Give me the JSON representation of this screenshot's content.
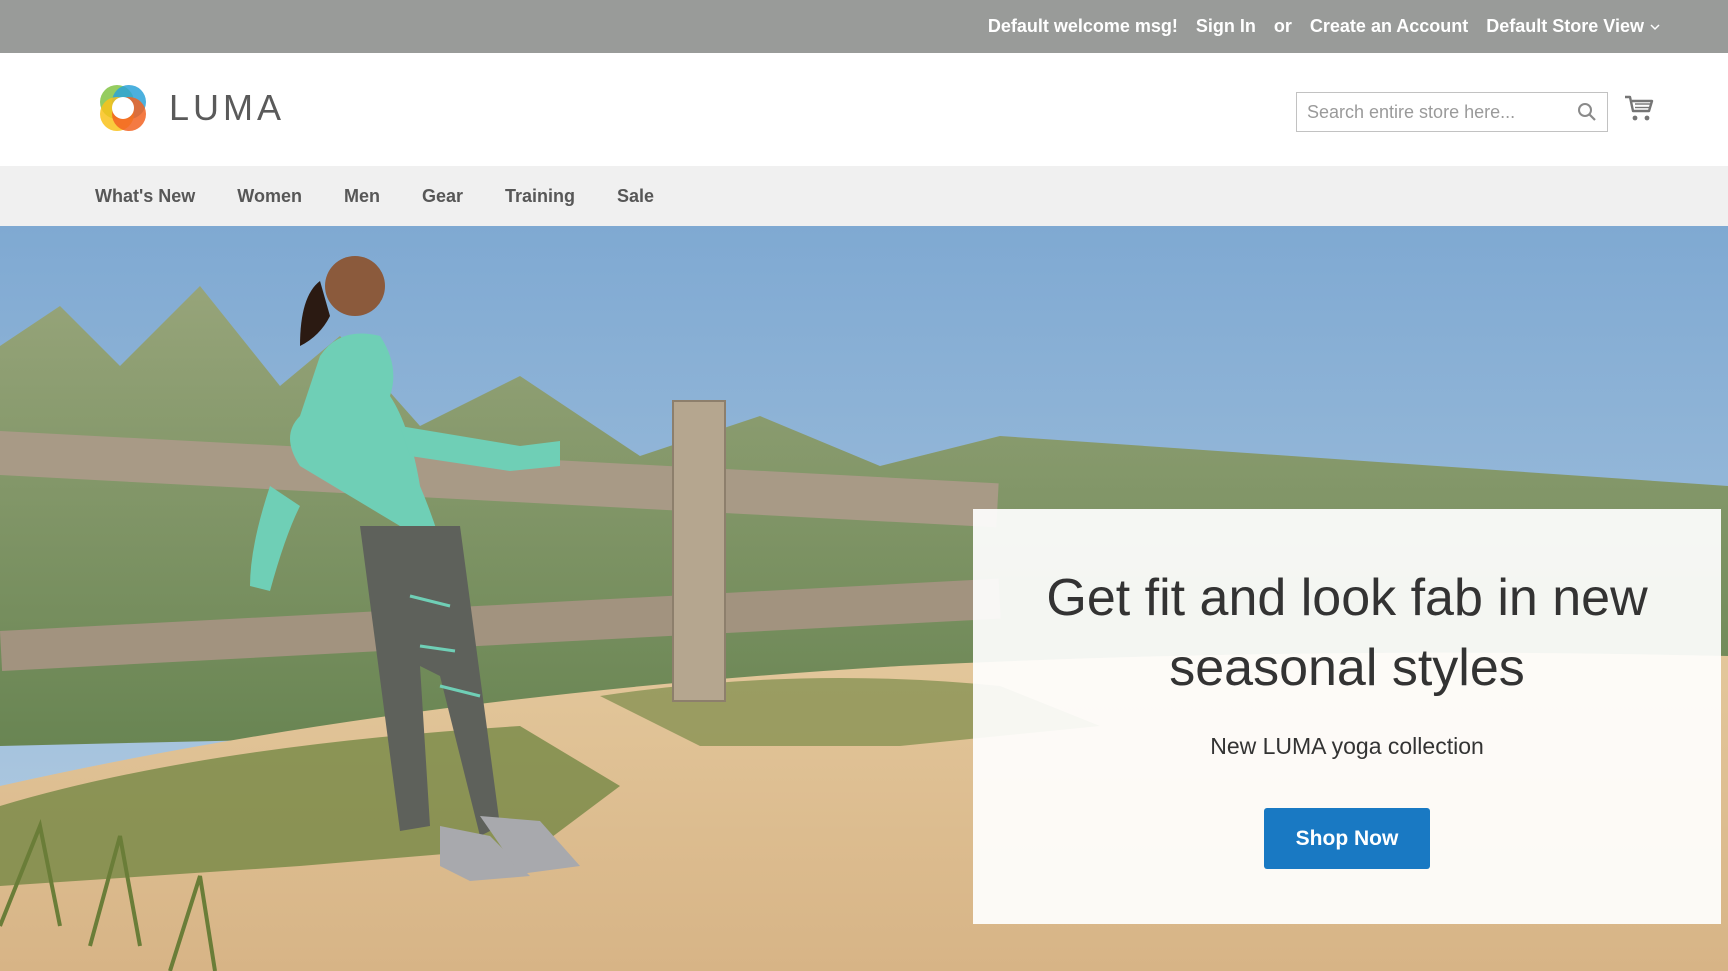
{
  "topbar": {
    "welcome": "Default welcome msg!",
    "sign_in": "Sign In",
    "or": "or",
    "create_account": "Create an Account",
    "store_view": "Default Store View"
  },
  "header": {
    "logo_text": "LUMA",
    "search_placeholder": "Search entire store here...",
    "search_icon": "search-icon",
    "cart_icon": "cart-icon"
  },
  "nav": {
    "items": [
      {
        "label": "What's New"
      },
      {
        "label": "Women"
      },
      {
        "label": "Men"
      },
      {
        "label": "Gear"
      },
      {
        "label": "Training"
      },
      {
        "label": "Sale"
      }
    ]
  },
  "promo": {
    "title": "Get fit and look fab in new seasonal styles",
    "subtitle": "New LUMA yoga collection",
    "button": "Shop Now"
  },
  "colors": {
    "topbar_bg": "#999b99",
    "nav_bg": "#f0f0f0",
    "accent": "#1979c3",
    "logo_orange": "#f26322",
    "logo_green": "#89c64f",
    "logo_blue": "#2ca2d8",
    "logo_yellow": "#f9c21b"
  }
}
